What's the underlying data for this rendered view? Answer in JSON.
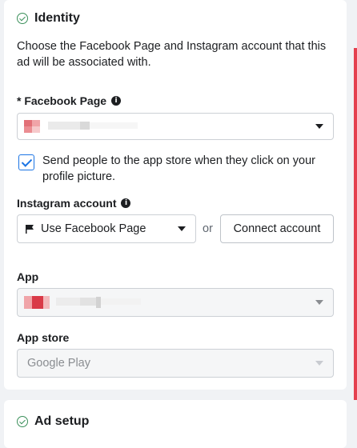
{
  "identity": {
    "title": "Identity",
    "description": "Choose the Facebook Page and Instagram account that this ad will be associated with.",
    "facebook_page": {
      "label": "* Facebook Page",
      "value": ""
    },
    "app_store_checkbox": {
      "checked": true,
      "label": "Send people to the app store when they click on your profile picture."
    },
    "instagram": {
      "label": "Instagram account",
      "selected": "Use Facebook Page",
      "or": "or",
      "connect_button": "Connect account"
    },
    "app": {
      "label": "App",
      "value": ""
    },
    "app_store": {
      "label": "App store",
      "selected": "Google Play"
    }
  },
  "ad_setup": {
    "title": "Ad setup"
  },
  "colors": {
    "accent": "#1b74e4",
    "success": "#3a8f5a",
    "redacted": "#e4404f"
  }
}
